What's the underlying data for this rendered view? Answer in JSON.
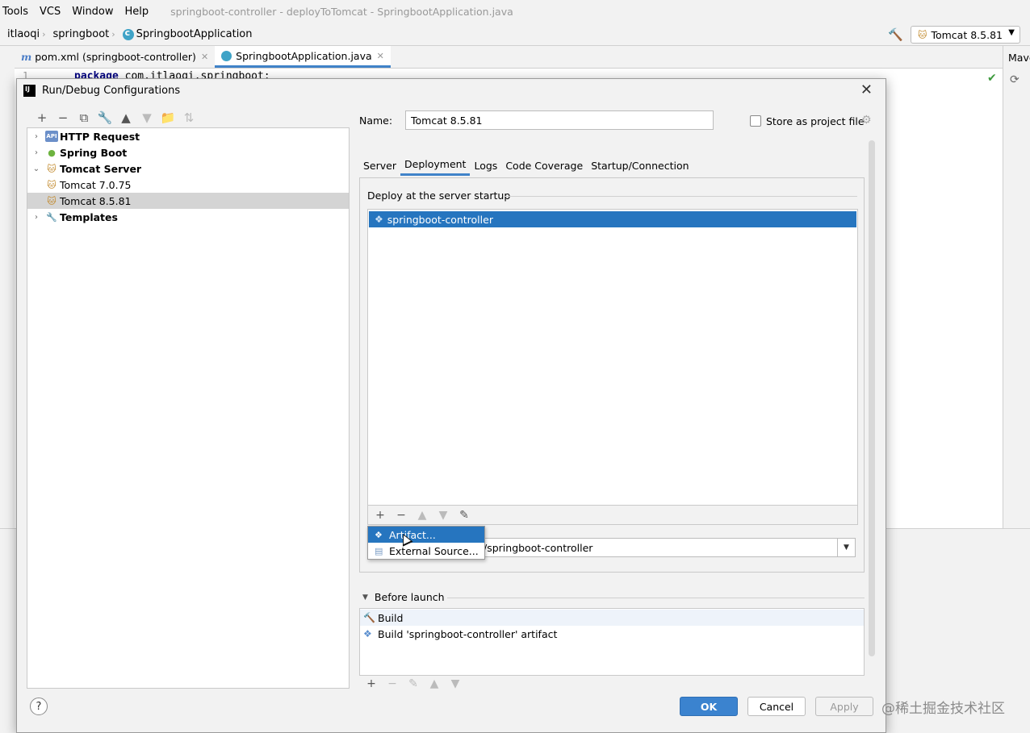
{
  "ide": {
    "menu_items": [
      "Tools",
      "VCS",
      "Window",
      "Help"
    ],
    "window_title": "springboot-controller - deployToTomcat - SpringbootApplication.java",
    "breadcrumbs": [
      "itlaoqi",
      "springboot",
      "SpringbootApplication"
    ],
    "run_config": "Tomcat 8.5.81",
    "editor_tabs": [
      {
        "label": "pom.xml (springboot-controller)"
      },
      {
        "label": "SpringbootApplication.java"
      }
    ],
    "line_number": "1",
    "code_keyword": "package",
    "code_rest": " com.itlaoqi.springboot;",
    "maven_label": "Mave",
    "watermark": "@稀土掘金技术社区"
  },
  "dialog": {
    "title": "Run/Debug Configurations",
    "tree": {
      "http_request": "HTTP Request",
      "spring_boot": "Spring Boot",
      "tomcat_server": "Tomcat Server",
      "tomcat_7": "Tomcat 7.0.75",
      "tomcat_8": "Tomcat 8.5.81",
      "templates": "Templates"
    },
    "name_label": "Name:",
    "name_value": "Tomcat 8.5.81",
    "store_label": "Store as project file",
    "tabs": [
      "Server",
      "Deployment",
      "Logs",
      "Code Coverage",
      "Startup/Connection"
    ],
    "active_tab": "Deployment",
    "deploy_title": "Deploy at the server startup",
    "deploy_items": [
      "springboot-controller"
    ],
    "context_value": "/springboot-controller",
    "popup": {
      "artifact": "Artifact...",
      "external": "External Source..."
    },
    "before_launch": {
      "title": "Before launch",
      "items": [
        "Build",
        "Build 'springboot-controller' artifact"
      ]
    },
    "buttons": {
      "help": "?",
      "ok": "OK",
      "cancel": "Cancel",
      "apply": "Apply"
    }
  }
}
